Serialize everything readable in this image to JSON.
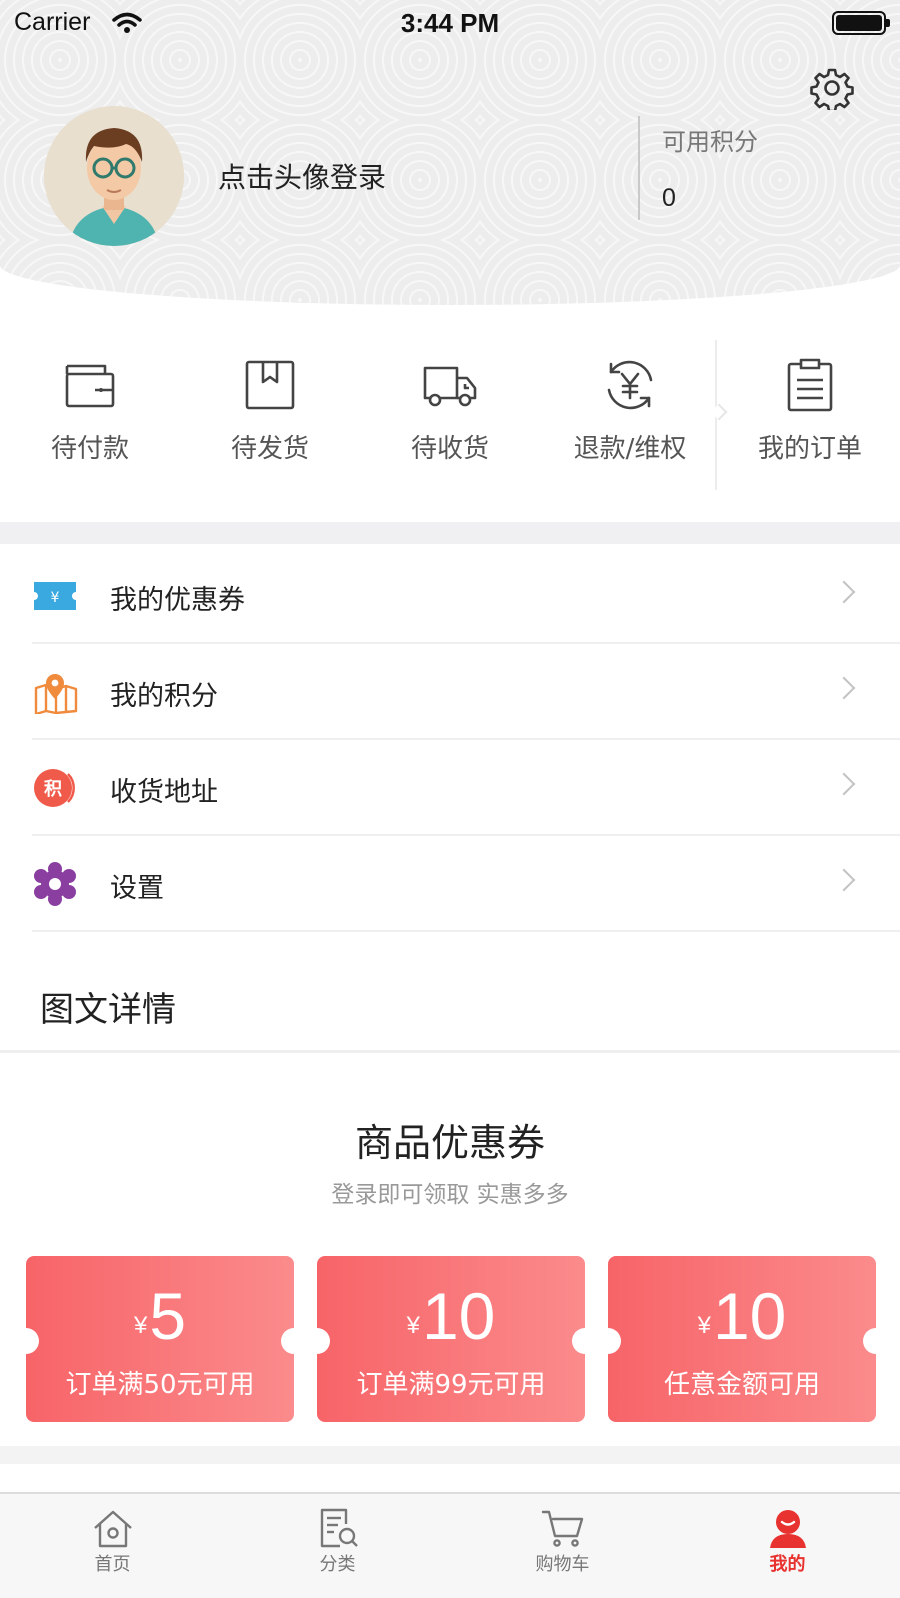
{
  "status_bar": {
    "carrier": "Carrier",
    "time": "3:44 PM"
  },
  "profile": {
    "login_prompt": "点击头像登录",
    "points_title": "可用积分",
    "points_value": "0"
  },
  "orders": [
    {
      "label": "待付款",
      "icon": "wallet-icon"
    },
    {
      "label": "待发货",
      "icon": "package-icon"
    },
    {
      "label": "待收货",
      "icon": "truck-icon"
    },
    {
      "label": "退款/维权",
      "icon": "refund-icon"
    },
    {
      "label": "我的订单",
      "icon": "clipboard-icon"
    }
  ],
  "menu": [
    {
      "label": "我的优惠券",
      "icon": "coupon-icon",
      "color": "#3aa9e0"
    },
    {
      "label": "我的积分",
      "icon": "map-pin-icon",
      "color": "#f08a3c"
    },
    {
      "label": "收货地址",
      "icon": "points-icon",
      "color": "#ef5a4a"
    },
    {
      "label": "设置",
      "icon": "flower-gear-icon",
      "color": "#8a3fa0"
    }
  ],
  "detail_section": {
    "title": "图文详情"
  },
  "coupons_section": {
    "heading": "商品优惠券",
    "subheading": "登录即可领取 实惠多多",
    "coupons": [
      {
        "currency": "¥",
        "amount": "5",
        "condition": "订单满50元可用"
      },
      {
        "currency": "¥",
        "amount": "10",
        "condition": "订单满99元可用"
      },
      {
        "currency": "¥",
        "amount": "10",
        "condition": "任意金额可用"
      }
    ]
  },
  "tabbar": {
    "active_color": "#e8322f",
    "tabs": [
      {
        "label": "首页",
        "icon": "home-icon"
      },
      {
        "label": "分类",
        "icon": "category-search-icon"
      },
      {
        "label": "购物车",
        "icon": "cart-icon"
      },
      {
        "label": "我的",
        "icon": "profile-icon",
        "active": true
      }
    ]
  }
}
